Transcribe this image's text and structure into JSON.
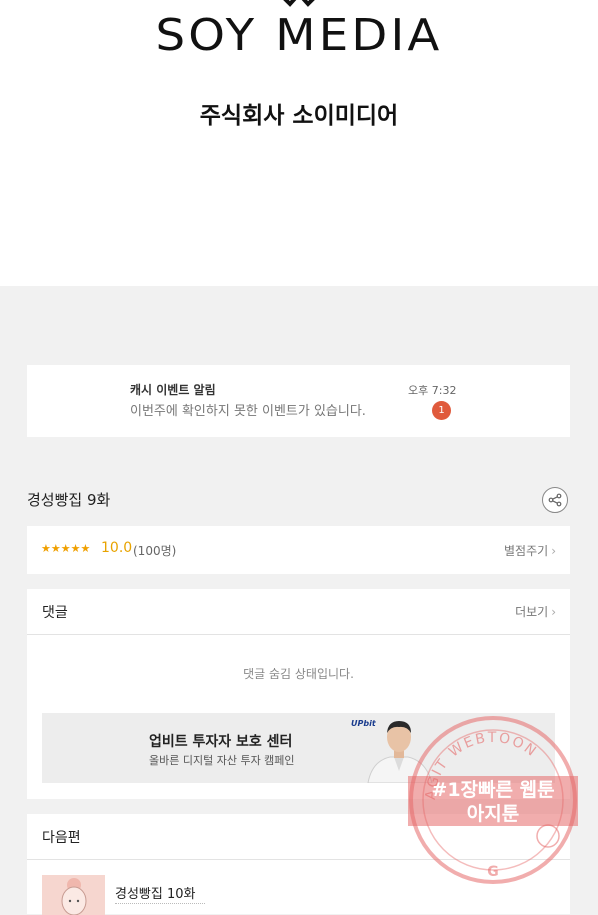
{
  "header": {
    "logo_text": "SOY MEDIA",
    "company_name": "주식회사 소이미디어"
  },
  "notification": {
    "title": "캐시 이벤트 알림",
    "message": "이번주에 확인하지 못한 이벤트가 있습니다.",
    "time": "오후 7:32",
    "badge_count": "1"
  },
  "episode": {
    "title": "경성빵집 9화",
    "share_icon": "share-icon"
  },
  "rating": {
    "stars": "★★★★★",
    "score": "10.0",
    "count": "(100명)",
    "rate_button": "별점주기"
  },
  "comments": {
    "title": "댓글",
    "more_button": "더보기",
    "hidden_message": "댓글 숨김 상태입니다."
  },
  "ad": {
    "title": "업비트 투자자 보호 센터",
    "subtitle": "올바른 디지털 자산 투자 캠페인",
    "brand": "UPbit"
  },
  "next_episode": {
    "section_title": "다음편",
    "episode_title": "경성빵집 10화"
  },
  "watermark": {
    "arc_text": "AGIT WEBTOON",
    "line1": "#1장빠른 웹툰",
    "line2": "아지툰"
  },
  "colors": {
    "badge": "#e05a3c",
    "score": "#e8a300",
    "watermark": "#e66a6a"
  }
}
